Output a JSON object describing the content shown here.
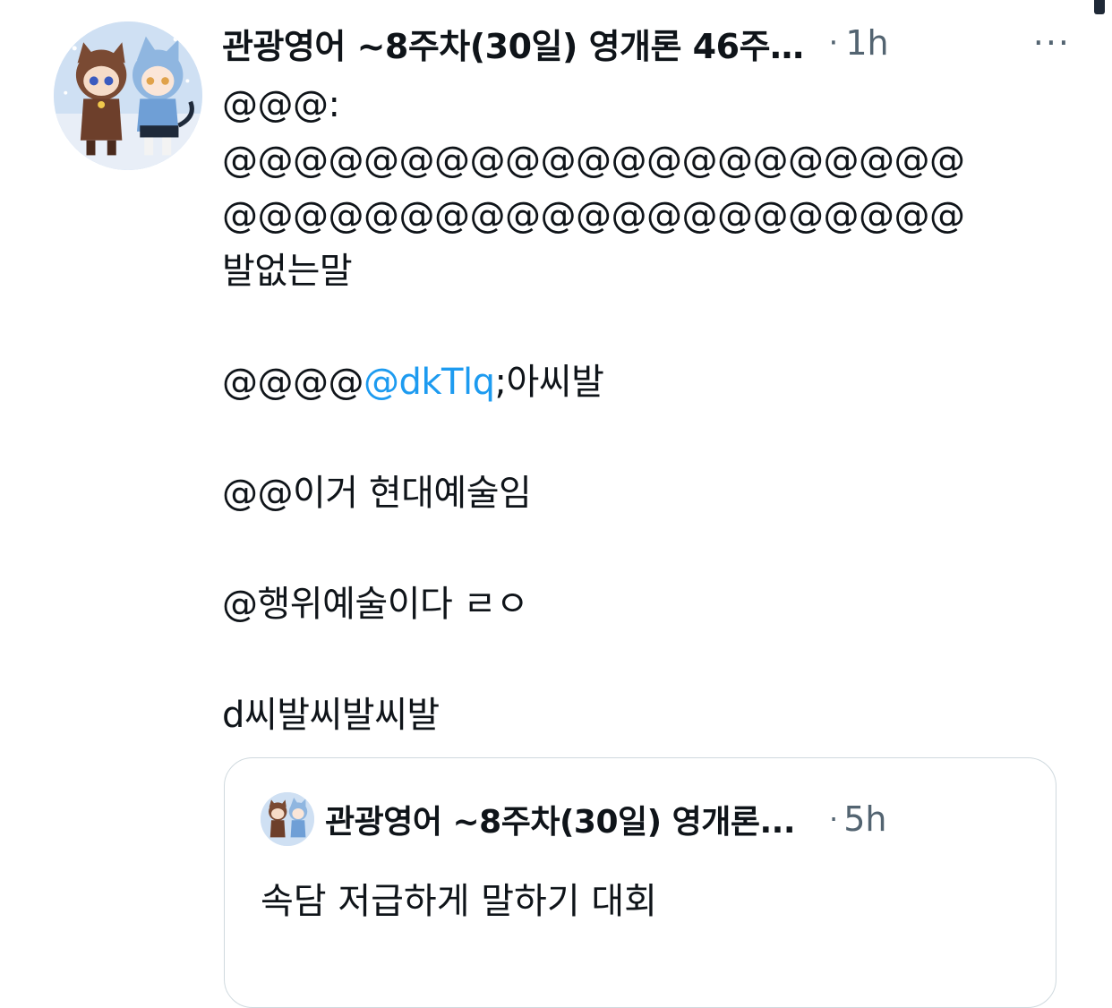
{
  "tweet": {
    "author_display_name": "관광영어 ~8주차(30일) 영개론 46주…",
    "dot": "·",
    "time": "1h",
    "more_icon": "···",
    "lines": [
      "@@@:",
      "@@@@@@@@@@@@@@@@@@@@@",
      "@@@@@@@@@@@@@@@@@@@@@",
      "발없는말",
      "",
      "@@@@",
      "",
      "@@이거 현대예술임",
      "",
      "@행위예술이다 ㄹㅇ",
      "",
      "d씨발씨발씨발"
    ],
    "mention_line": {
      "before": "@@@@",
      "mention": "@dkTlq",
      "after": ";아씨발"
    }
  },
  "quoted_tweet": {
    "author_display_name": "관광영어 ~8주차(30일) 영개론...",
    "dot": "·",
    "time": "5h",
    "text": "속담 저급하게 말하기 대회"
  },
  "colors": {
    "text": "#0f1419",
    "muted": "#536471",
    "mention": "#1d9bf0",
    "border": "#cfd9de"
  }
}
